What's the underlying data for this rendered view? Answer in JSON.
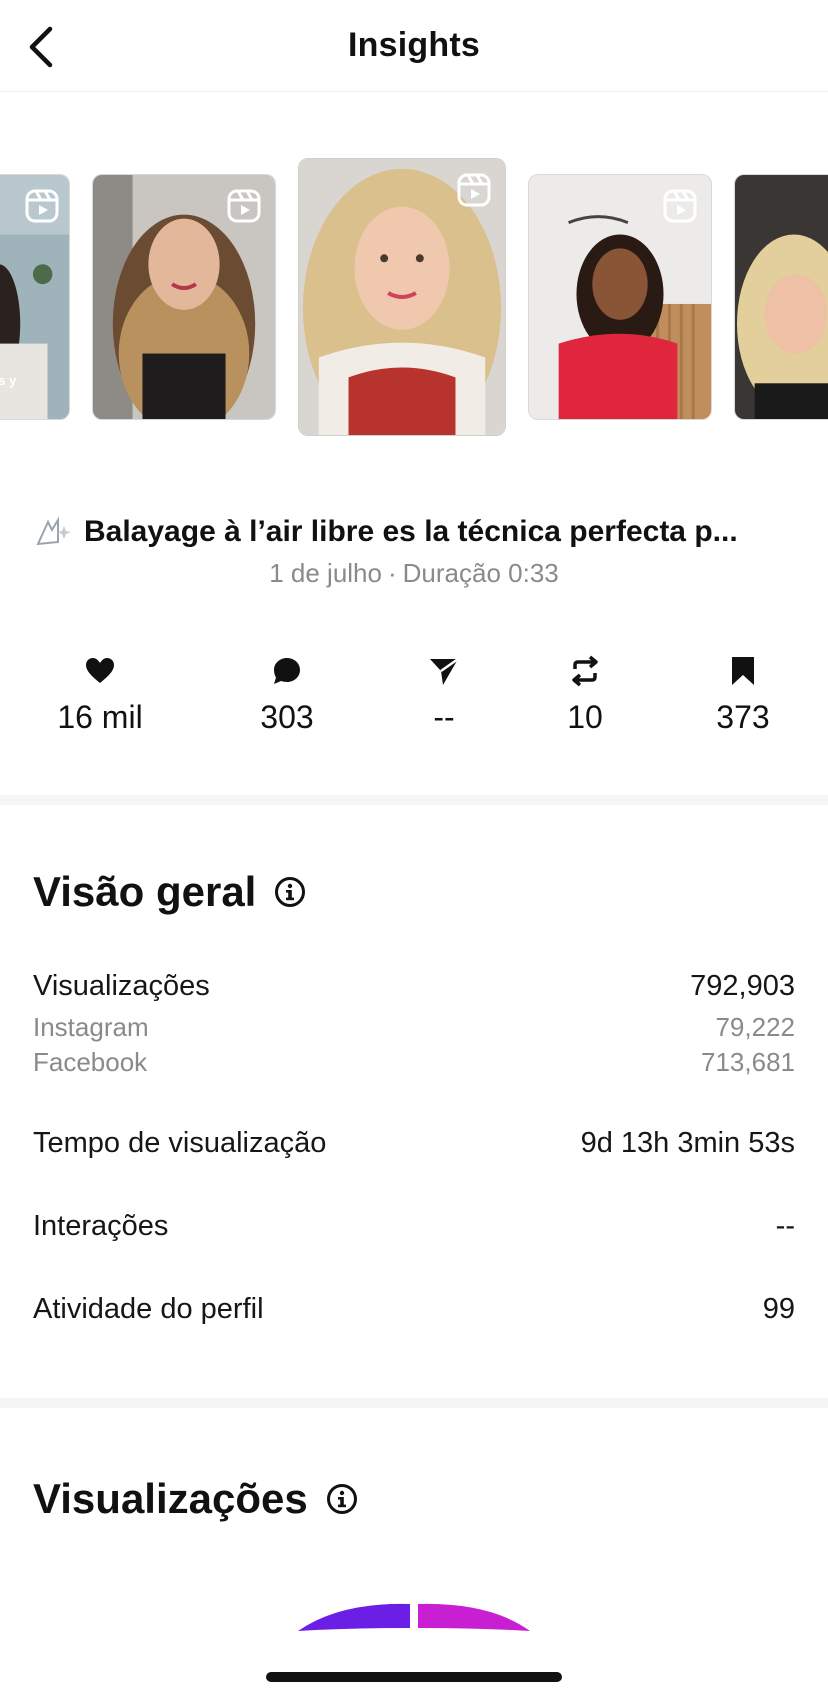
{
  "header": {
    "title": "Insights",
    "back_icon": "chevron-left-icon"
  },
  "carousel": {
    "items": [
      {
        "kind": "reel",
        "caption_fragment": "as y"
      },
      {
        "kind": "reel"
      },
      {
        "kind": "reel",
        "selected": true
      },
      {
        "kind": "reel"
      },
      {
        "kind": "reel"
      }
    ],
    "reel_icon": "reels-icon"
  },
  "post": {
    "title": "Balayage à l’air libre es la técnica perfecta p...",
    "date": "1 de julho",
    "separator": "·",
    "duration": "Duração 0:33"
  },
  "stats": [
    {
      "icon": "heart-icon",
      "value": "16 mil"
    },
    {
      "icon": "comment-icon",
      "value": "303"
    },
    {
      "icon": "share-icon",
      "value": "--"
    },
    {
      "icon": "repost-icon",
      "value": "10"
    },
    {
      "icon": "bookmark-icon",
      "value": "373"
    }
  ],
  "overview": {
    "title": "Visão geral",
    "rows": {
      "views": {
        "label": "Visualizações",
        "value": "792,903"
      },
      "instagram": {
        "label": "Instagram",
        "value": "79,222"
      },
      "facebook": {
        "label": "Facebook",
        "value": "713,681"
      },
      "watch_time": {
        "label": "Tempo de visualização",
        "value": "9d 13h 3min 53s"
      },
      "interactions": {
        "label": "Interações",
        "value": "--"
      },
      "profile_activity": {
        "label": "Atividade do perfil",
        "value": "99"
      }
    }
  },
  "views_section": {
    "title": "Visualizações"
  },
  "colors": {
    "accent_instagram": "#6a1ee6",
    "accent_facebook": "#c81fd2",
    "muted_text": "#8a8a8a"
  }
}
